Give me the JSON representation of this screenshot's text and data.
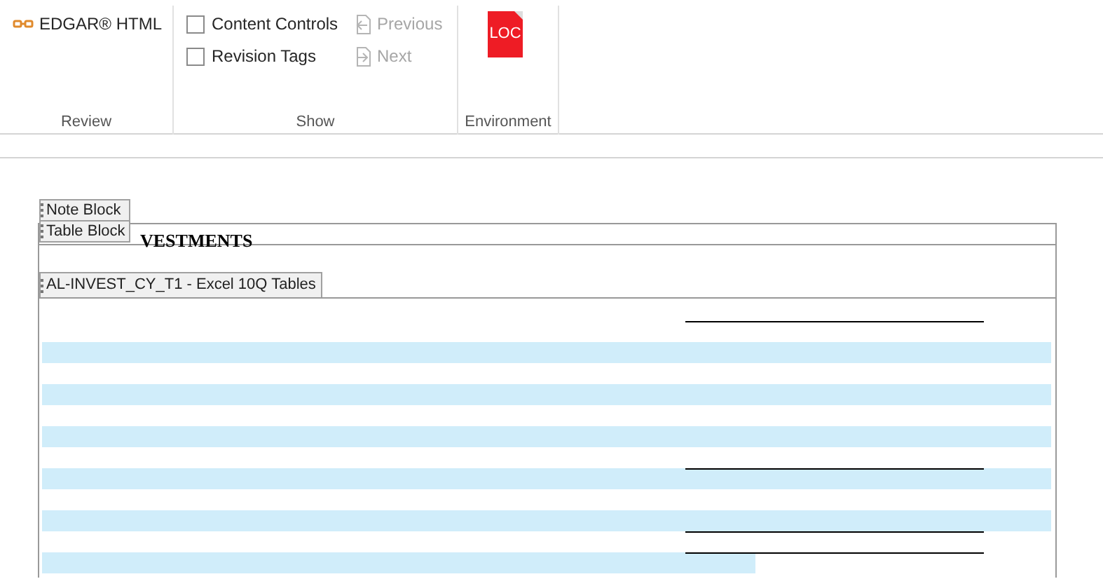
{
  "ribbon": {
    "groups": [
      {
        "label": "Review",
        "items": [
          {
            "kind": "button",
            "label": "EDGAR® HTML"
          }
        ]
      },
      {
        "label": "Show",
        "items": [
          {
            "kind": "checkbox",
            "label": "Content Controls",
            "checked": false
          },
          {
            "kind": "checkbox",
            "label": "Revision Tags",
            "checked": false
          },
          {
            "kind": "previous",
            "label": "Previous",
            "disabled": true
          },
          {
            "kind": "next",
            "label": "Next",
            "disabled": true
          }
        ]
      },
      {
        "label": "Environment",
        "items": [
          {
            "kind": "doc",
            "label": "LOC"
          }
        ]
      }
    ]
  },
  "document": {
    "block_tags": [
      "Note Block",
      "Table Block"
    ],
    "heading": "VESTMENTS",
    "table_tag": "AL-INVEST_CY_T1 - Excel 10Q Tables"
  }
}
